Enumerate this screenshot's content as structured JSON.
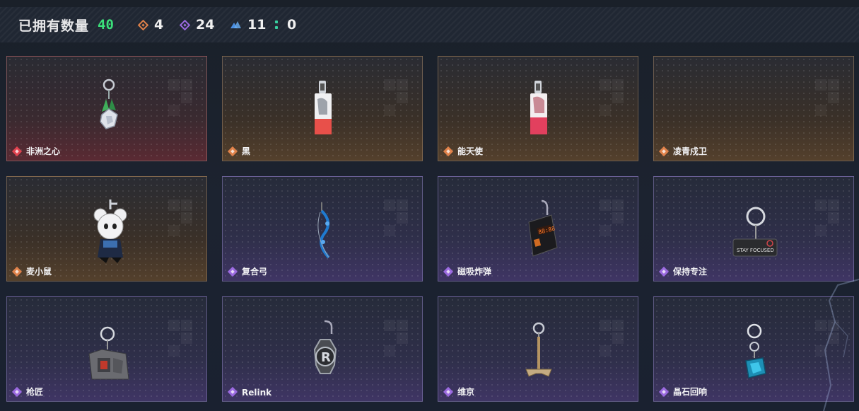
{
  "header": {
    "owned_label": "已拥有数量",
    "owned_count": "40",
    "stats": [
      {
        "icon": "orange-diamond-icon",
        "value": "4",
        "color": "#e0824a"
      },
      {
        "icon": "purple-diamond-icon",
        "value": "24",
        "color": "#9b6ae0"
      },
      {
        "icon": "blue-triangles-icon",
        "value": "11",
        "color": "#4a8ee0"
      },
      {
        "icon": "green-dots-icon",
        "value": "0",
        "color": "#38d1a0"
      }
    ]
  },
  "rarity_colors": {
    "red": "#e0424f",
    "orange": "#e0824a",
    "purple": "#9b6ae0"
  },
  "items": [
    {
      "name": "非洲之心",
      "rarity": "red",
      "icon": "heart-of-africa-charm-icon"
    },
    {
      "name": "黑",
      "rarity": "orange",
      "icon": "card-charm-black-icon"
    },
    {
      "name": "能天使",
      "rarity": "orange",
      "icon": "card-charm-exusiai-icon"
    },
    {
      "name": "凌青戍卫",
      "rarity": "orange",
      "icon": "empty-charm-icon"
    },
    {
      "name": "麦小鼠",
      "rarity": "orange",
      "icon": "mouse-figure-charm-icon"
    },
    {
      "name": "复合弓",
      "rarity": "purple",
      "icon": "compound-bow-charm-icon"
    },
    {
      "name": "磁吸炸弹",
      "rarity": "purple",
      "icon": "magnetic-bomb-charm-icon"
    },
    {
      "name": "保持专注",
      "rarity": "purple",
      "icon": "stay-focused-charm-icon"
    },
    {
      "name": "枪匠",
      "rarity": "purple",
      "icon": "gunsmith-charm-icon"
    },
    {
      "name": "Relink",
      "rarity": "purple",
      "icon": "relink-charm-icon"
    },
    {
      "name": "维京",
      "rarity": "purple",
      "icon": "viking-hammer-charm-icon"
    },
    {
      "name": "晶石回响",
      "rarity": "purple",
      "icon": "crystal-echo-charm-icon"
    }
  ],
  "stay_focused_text": "STAY FOCUSED",
  "relink_letter": "R",
  "bomb_readout": "88:88"
}
